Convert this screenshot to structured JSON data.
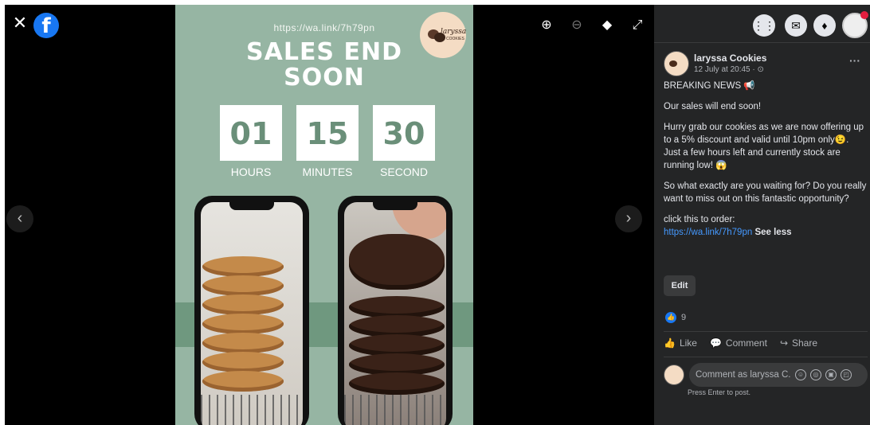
{
  "viewer": {
    "close_icon": "✕",
    "fb_letter": "f",
    "tools": {
      "zoom_in": "⊕",
      "zoom_out": "⊖",
      "tag": "◆",
      "fullscreen": "⤢"
    },
    "prev_arrow": "‹",
    "next_arrow": "›"
  },
  "poster": {
    "url": "https://wa.link/7h79pn",
    "logo_brand": "laryssa",
    "logo_sub": "COOKIES",
    "title_line1": "SALES END",
    "title_line2": "SOON",
    "countdown": [
      {
        "value": "01",
        "label": "HOURS"
      },
      {
        "value": "15",
        "label": "MINUTES"
      },
      {
        "value": "30",
        "label": "SECOND"
      }
    ]
  },
  "topbar": {
    "menu_icon": "⋮⋮",
    "messenger_icon": "✉",
    "notification_icon": "♦"
  },
  "post": {
    "author": "laryssa Cookies",
    "timestamp": "12 July at 20:45 · ⊙",
    "more_icon": "···",
    "heading": "BREAKING NEWS 📢",
    "p1": "Our sales will end soon!",
    "p2": "Hurry grab our cookies as we are now offering up to a 5% discount and valid until 10pm only😉. Just a few hours left and currently stock are running low! 😱",
    "p3": "So what exactly are you waiting for? Do you really want to miss out on this fantastic opportunity?",
    "p4_prefix": "click this to order:",
    "link": "https://wa.link/7h79pn",
    "see_less": "See less",
    "edit_label": "Edit",
    "reaction_count": "9",
    "like_label": "Like",
    "comment_label": "Comment",
    "share_label": "Share",
    "comment_placeholder": "Comment as laryssa C...",
    "press_enter_hint": "Press Enter to post."
  }
}
